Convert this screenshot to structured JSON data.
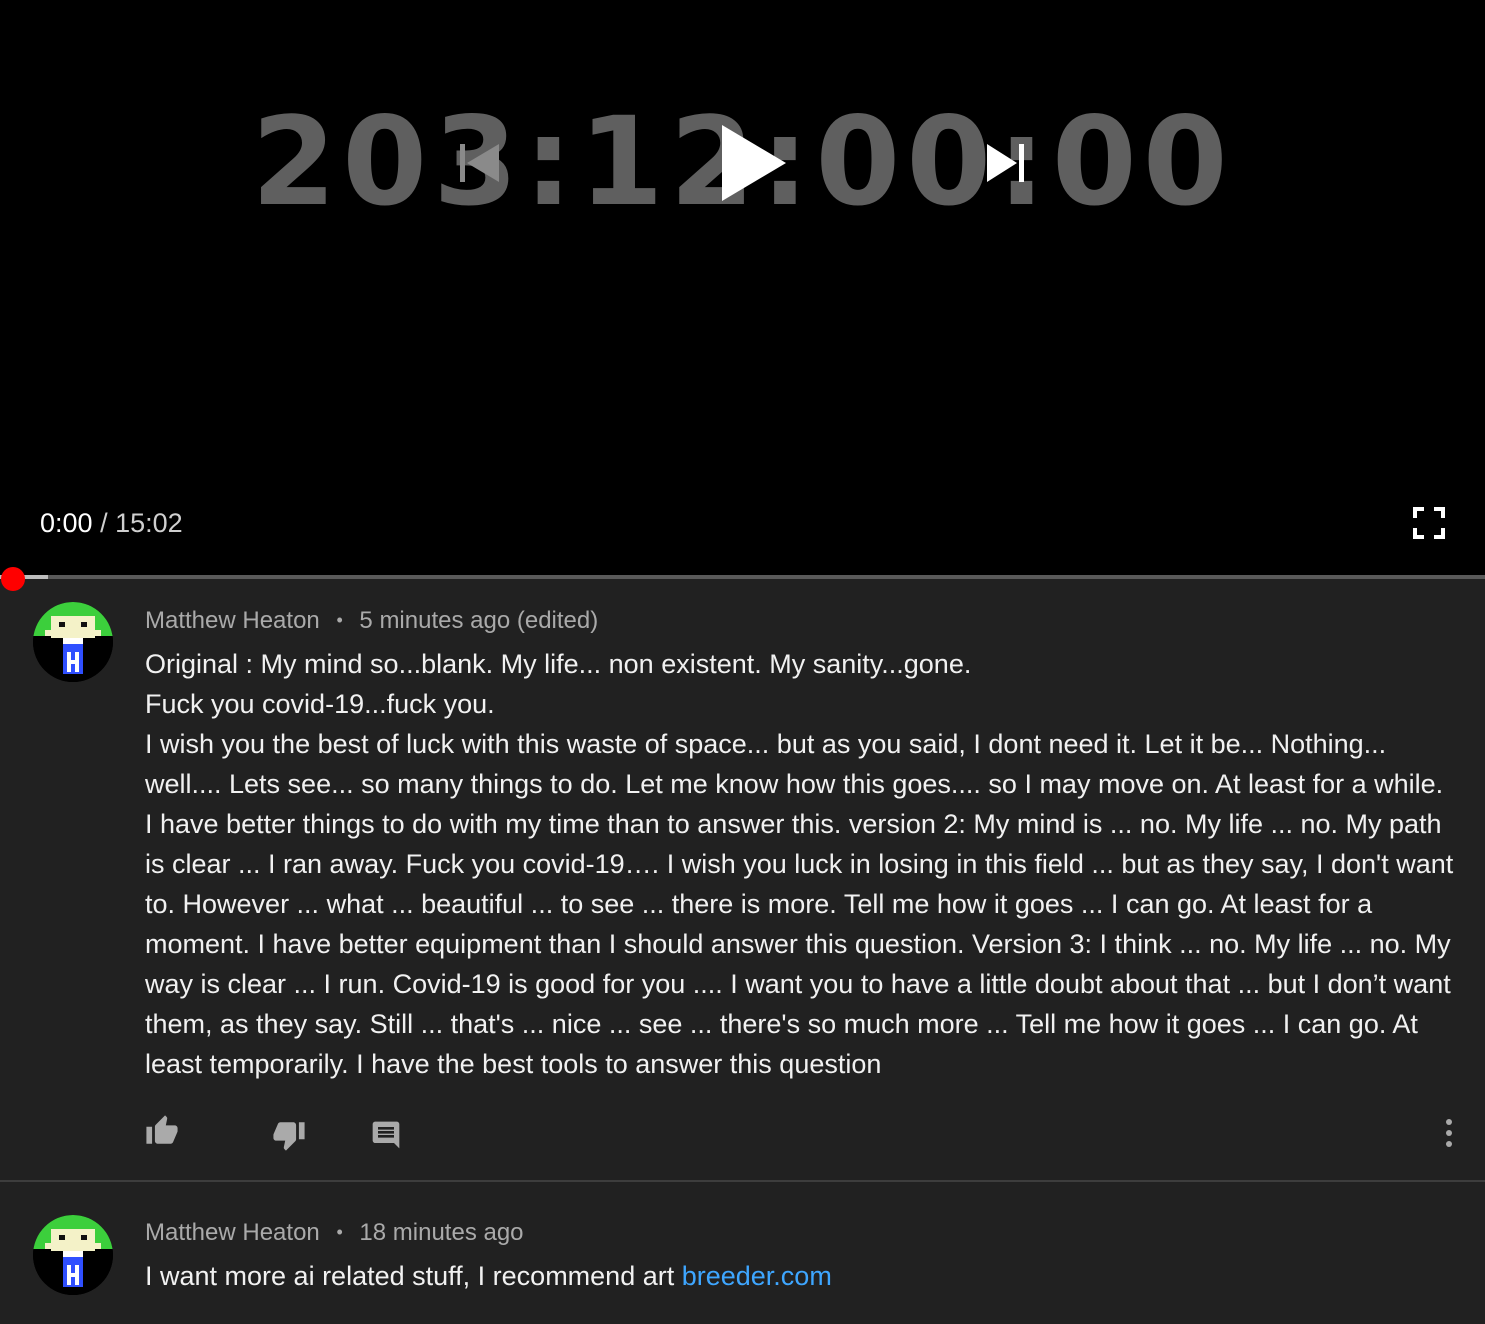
{
  "player": {
    "video_overlay_text": "203:12:00:00",
    "current_time": "0:00",
    "time_separator": "/",
    "duration": "15:02",
    "progress_fraction": 0.0,
    "controls": {
      "previous_icon": "skip-previous-icon",
      "play_icon": "play-icon",
      "next_icon": "skip-next-icon",
      "fullscreen_icon": "fullscreen-icon"
    },
    "accent_color": "#ff0000"
  },
  "comments": [
    {
      "author": "Matthew Heaton",
      "separator": "•",
      "timestamp": "5 minutes ago (edited)",
      "lines": [
        "Original : My mind so...blank. My life... non existent. My sanity...gone.",
        "Fuck you covid-19...fuck you.",
        "I wish you the best of luck with this waste of space... but as you said, I dont need it. Let it be... Nothing... well.... Lets see... so many things to do. Let me know how this goes.... so I may move on. At least for a while. I have better things to do with my time than to answer this. version 2: My mind is ... no. My life ... no. My path is clear ... I ran away. Fuck you covid-19…. I wish you luck in losing in this field ... but as they say, I don't want to. However ... what ... beautiful ... to see ... there is more. Tell me how it goes ... I can go. At least for a moment. I have better equipment than I should answer this question.  Version 3: I think ... no. My life ... no. My way is clear ... I run. Covid-19 is good for you .... I want you to have a little doubt about that ... but I don’t want them, as they say. Still ... that's ... nice ... see ... there's so much more ... Tell me how it goes ... I can go. At least temporarily. I have the best tools to answer this question"
      ],
      "actions": {
        "like_icon": "thumbs-up-icon",
        "dislike_icon": "thumbs-down-icon",
        "reply_icon": "reply-comment-icon",
        "more_icon": "more-vertical-icon"
      }
    },
    {
      "author": "Matthew Heaton",
      "separator": "•",
      "timestamp": "18 minutes ago",
      "text_prefix": "I want more ai related stuff, I recommend art ",
      "link_text": "breeder.com",
      "link_color": "#3ea6ff"
    }
  ]
}
